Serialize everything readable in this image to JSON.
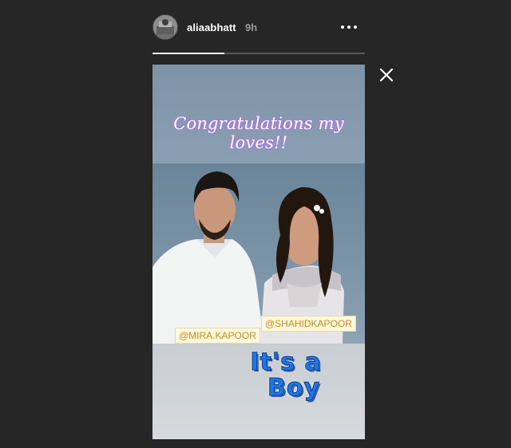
{
  "story": {
    "username": "aliaabhatt",
    "time_ago": "9h",
    "progress_fraction": 0.34,
    "caption": "Congratulations my loves!!",
    "tags": {
      "mira": "@MIRA.KAPOOR",
      "shahid": "@SHAHIDKAPOOR"
    },
    "sticker": {
      "line1": "It's a",
      "line2": "Boy"
    }
  },
  "icons": {
    "more": "more-horizontal-icon",
    "close": "close-icon",
    "avatar": "profile-avatar"
  },
  "colors": {
    "background": "#262626",
    "progress_fill": "#ffffff",
    "progress_track": "#5a5a5a",
    "tag_text": "#c98a1e",
    "sticker": "#1e78e6"
  }
}
